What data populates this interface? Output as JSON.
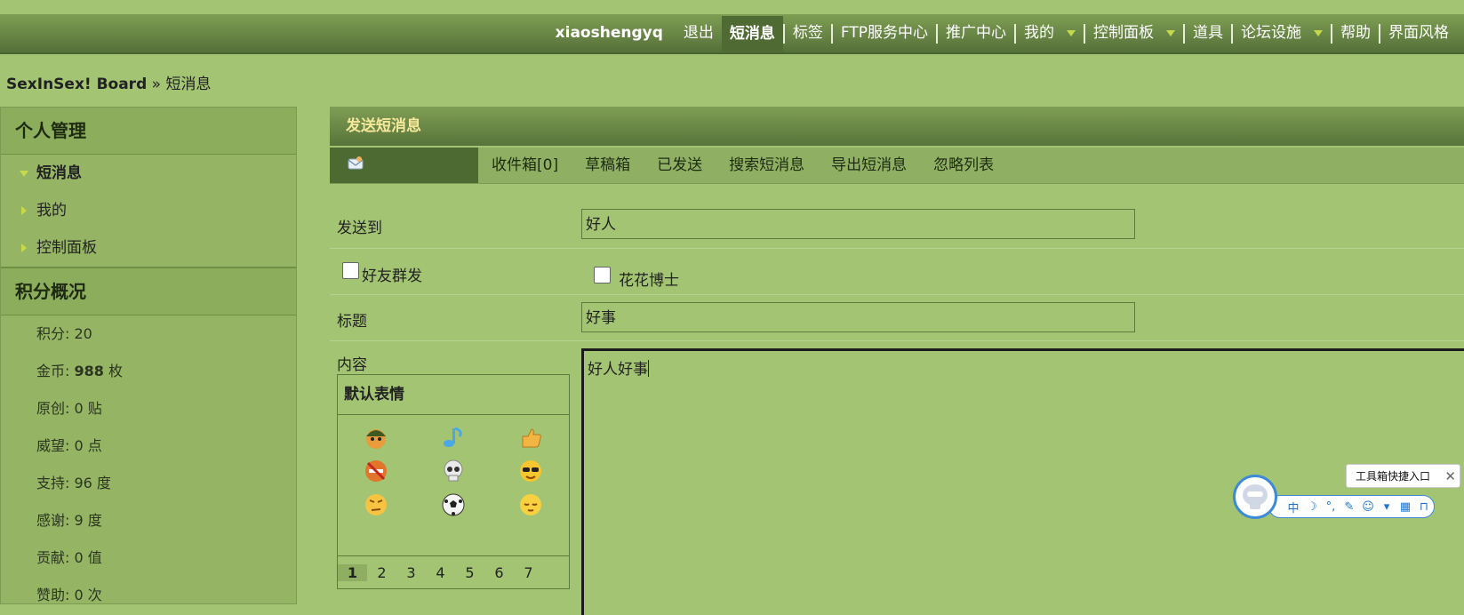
{
  "nav": {
    "username": "xiaoshengyq",
    "items": [
      "退出",
      "短消息",
      "标签",
      "FTP服务中心",
      "推广中心",
      "我的",
      "控制面板",
      "道具",
      "论坛设施",
      "帮助",
      "界面风格"
    ]
  },
  "breadcrumb": {
    "site": "SexInSex! Board",
    "sep": " » ",
    "page": "短消息"
  },
  "sidebar": {
    "section1_title": "个人管理",
    "items": [
      "短消息",
      "我的",
      "控制面板"
    ],
    "section2_title": "积分概况",
    "stats": [
      {
        "label": "积分: ",
        "value": "20",
        "unit": ""
      },
      {
        "label": "金币: ",
        "value": "988",
        "unit": " 枚"
      },
      {
        "label": "原创: ",
        "value": "0",
        "unit": " 贴"
      },
      {
        "label": "威望: ",
        "value": "0",
        "unit": " 点"
      },
      {
        "label": "支持: ",
        "value": "96",
        "unit": " 度"
      },
      {
        "label": "感谢: ",
        "value": "9",
        "unit": " 度"
      },
      {
        "label": "贡献: ",
        "value": "0",
        "unit": " 值"
      },
      {
        "label": "赞助: ",
        "value": "0",
        "unit": " 次"
      }
    ]
  },
  "panel": {
    "title": "发送短消息",
    "tabs": [
      "收件箱[0]",
      "草稿箱",
      "已发送",
      "搜索短消息",
      "导出短消息",
      "忽略列表"
    ]
  },
  "form": {
    "to_label": "发送到",
    "to_value": "好人",
    "group_label": "好友群发",
    "friend_name": "花花博士",
    "subject_label": "标题",
    "subject_value": "好事",
    "content_label": "内容",
    "content_value": "好人好事"
  },
  "smilies": {
    "title": "默认表情",
    "pages": [
      "1",
      "2",
      "3",
      "4",
      "5",
      "6",
      "7"
    ],
    "current_page": "1"
  },
  "toolbox": {
    "tip": "工具箱快捷入口",
    "buttons": [
      "中",
      "☽",
      "°,",
      "✎",
      "☺",
      "▾",
      "▦",
      "⊓"
    ]
  },
  "colors": {
    "page_bg": "#a3c472",
    "nav_bg": "#55703a",
    "accent": "#f6e89a"
  }
}
